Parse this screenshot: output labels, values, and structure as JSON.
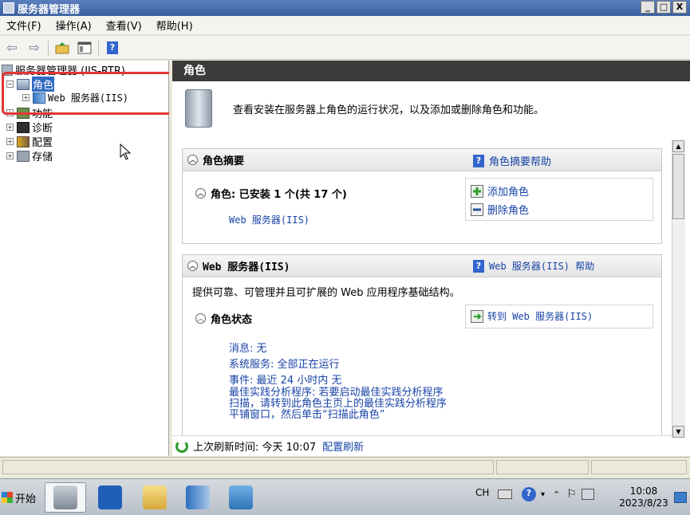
{
  "window": {
    "title": "服务器管理器",
    "minimize": "_",
    "maximize": "□",
    "close": "X"
  },
  "menu": [
    "文件(F)",
    "操作(A)",
    "查看(V)",
    "帮助(H)"
  ],
  "toolbar": {
    "back": "⇦",
    "forward": "⇨",
    "help": "?"
  },
  "tree": {
    "root": "服务器管理器 (IIS-RTR)",
    "roles": "角色",
    "web_server": "Web 服务器(IIS)",
    "features": "功能",
    "diagnostics": "诊断",
    "config": "配置",
    "storage": "存储",
    "expand_symbol": "+",
    "collapse_symbol": "−"
  },
  "main": {
    "header": "角色",
    "intro": "查看安装在服务器上角色的运行状况，以及添加或删除角色和功能。",
    "summary_panel": {
      "title": "角色摘要",
      "help_link": "角色摘要帮助",
      "roles_label": "角色: 已安装 1 个(共 17 个)",
      "installed_role": "Web 服务器(IIS)",
      "add_roles": "添加角色",
      "remove_roles": "删除角色"
    },
    "web_panel": {
      "title": "Web 服务器(IIS)",
      "help_link": "Web 服务器(IIS) 帮助",
      "description": "提供可靠、可管理并且可扩展的 Web 应用程序基础结构。",
      "status_title": "角色状态",
      "goto_link": "转到 Web 服务器(IIS)",
      "messages": "消息: 无",
      "system_services": "系统服务: 全部正在运行",
      "events": "事件: 最近 24 小时内 无",
      "bpa_line1": "最佳实践分析程序: 若要启动最佳实践分析程序",
      "bpa_line2": "扫描，请转到此角色主页上的最佳实践分析程序",
      "bpa_line3": "平铺窗口，然后单击“扫描此角色”"
    },
    "refresh": {
      "label": "上次刷新时间: 今天 10:07",
      "link": "配置刷新"
    }
  },
  "taskbar": {
    "start": "开始",
    "lang": "CH",
    "time": "10:08",
    "date": "2023/8/23"
  },
  "colors": {
    "link": "#1a44a8",
    "header_bg": "#3b3b3b",
    "highlight": "#e53535",
    "selection": "#316ac5"
  }
}
